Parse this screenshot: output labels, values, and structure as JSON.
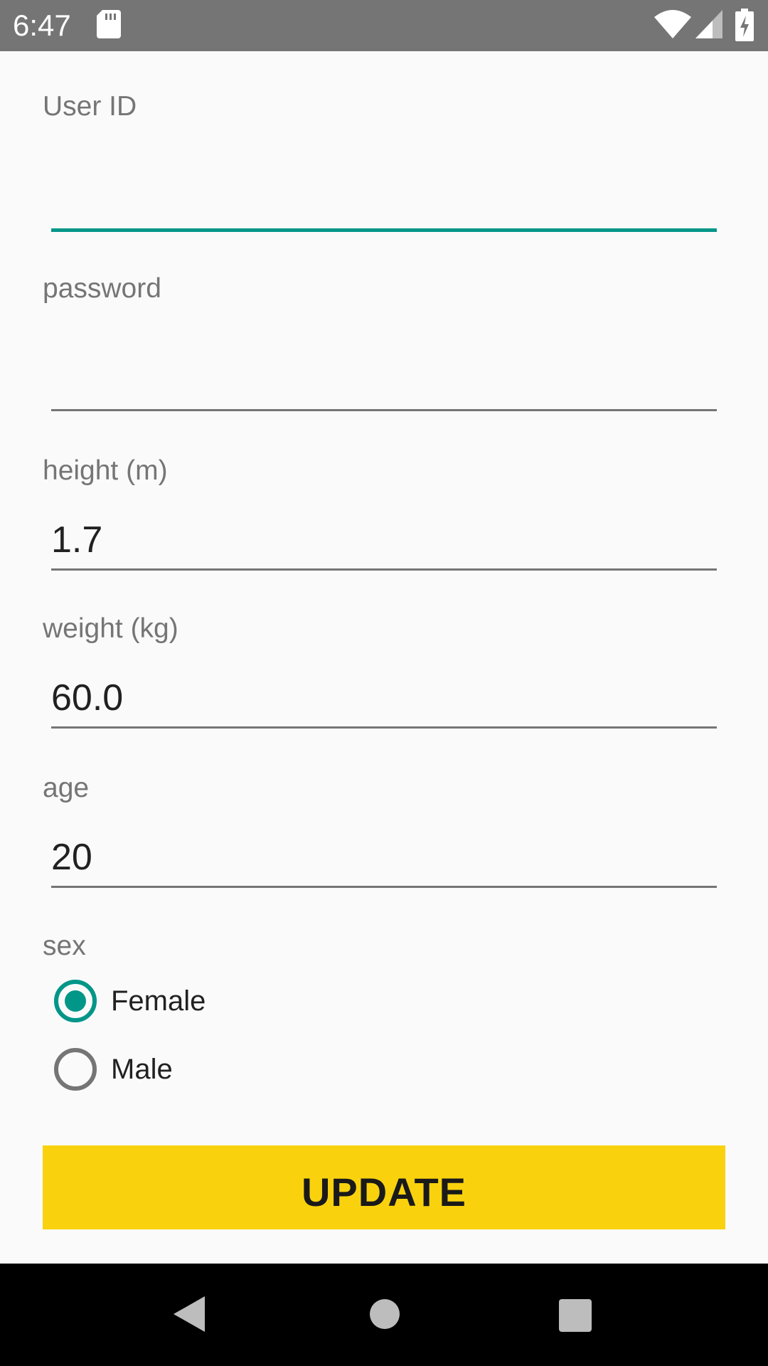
{
  "status_bar": {
    "time": "6:47",
    "icons": [
      "sd-card-icon",
      "wifi-icon",
      "signal-icon",
      "battery-charging-icon"
    ]
  },
  "form": {
    "user_id": {
      "label": "User ID",
      "value": ""
    },
    "password": {
      "label": "password",
      "value": ""
    },
    "height": {
      "label": "height (m)",
      "value": "1.7"
    },
    "weight": {
      "label": "weight (kg)",
      "value": "60.0"
    },
    "age": {
      "label": "age",
      "value": "20"
    },
    "sex": {
      "label": "sex",
      "options": [
        {
          "label": "Female",
          "checked": true
        },
        {
          "label": "Male",
          "checked": false
        }
      ]
    },
    "update_label": "UPDATE"
  },
  "colors": {
    "accent": "#009688",
    "button": "#f9d20d",
    "status_bar": "#757575",
    "nav_bar": "#000000"
  },
  "nav_bar": {
    "icons": [
      "back-icon",
      "home-icon",
      "recent-apps-icon"
    ]
  }
}
